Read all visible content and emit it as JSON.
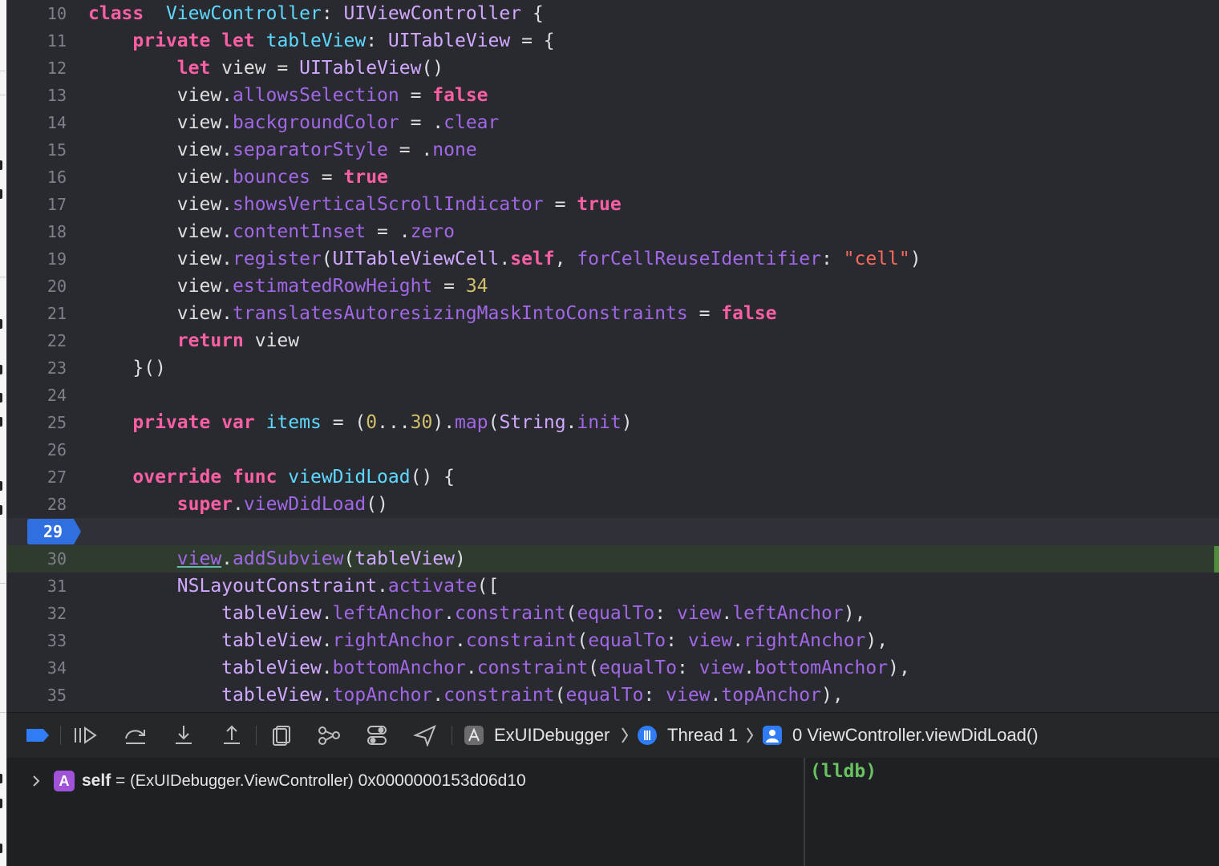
{
  "editor": {
    "lines": [
      {
        "n": "10",
        "code": [
          [
            "kw",
            "class"
          ],
          [
            "",
            "  "
          ],
          [
            "dc",
            "ViewController"
          ],
          [
            "",
            ": "
          ],
          [
            "ty",
            "UIViewController"
          ],
          [
            "",
            " {"
          ]
        ]
      },
      {
        "n": "11",
        "code": [
          [
            "",
            "    "
          ],
          [
            "kw",
            "private"
          ],
          [
            "",
            " "
          ],
          [
            "kw",
            "let"
          ],
          [
            "",
            " "
          ],
          [
            "dc",
            "tableView"
          ],
          [
            "",
            ": "
          ],
          [
            "ty",
            "UITableView"
          ],
          [
            "",
            " = {"
          ]
        ]
      },
      {
        "n": "12",
        "code": [
          [
            "",
            "        "
          ],
          [
            "kw",
            "let"
          ],
          [
            "",
            " view = "
          ],
          [
            "ty",
            "UITableView"
          ],
          [
            "",
            "()"
          ]
        ]
      },
      {
        "n": "13",
        "code": [
          [
            "",
            "        view."
          ],
          [
            "pr",
            "allowsSelection"
          ],
          [
            "",
            " = "
          ],
          [
            "kw",
            "false"
          ]
        ]
      },
      {
        "n": "14",
        "code": [
          [
            "",
            "        view."
          ],
          [
            "pr",
            "backgroundColor"
          ],
          [
            "",
            " = ."
          ],
          [
            "pr",
            "clear"
          ]
        ]
      },
      {
        "n": "15",
        "code": [
          [
            "",
            "        view."
          ],
          [
            "pr",
            "separatorStyle"
          ],
          [
            "",
            " = ."
          ],
          [
            "pr",
            "none"
          ]
        ]
      },
      {
        "n": "16",
        "code": [
          [
            "",
            "        view."
          ],
          [
            "pr",
            "bounces"
          ],
          [
            "",
            " = "
          ],
          [
            "kw",
            "true"
          ]
        ]
      },
      {
        "n": "17",
        "code": [
          [
            "",
            "        view."
          ],
          [
            "pr",
            "showsVerticalScrollIndicator"
          ],
          [
            "",
            " = "
          ],
          [
            "kw",
            "true"
          ]
        ]
      },
      {
        "n": "18",
        "code": [
          [
            "",
            "        view."
          ],
          [
            "pr",
            "contentInset"
          ],
          [
            "",
            " = ."
          ],
          [
            "pr",
            "zero"
          ]
        ]
      },
      {
        "n": "19",
        "code": [
          [
            "",
            "        view."
          ],
          [
            "pr",
            "register"
          ],
          [
            "",
            "("
          ],
          [
            "ty",
            "UITableViewCell"
          ],
          [
            "",
            "."
          ],
          [
            "kw",
            "self"
          ],
          [
            "",
            ", "
          ],
          [
            "pr",
            "forCellReuseIdentifier"
          ],
          [
            "",
            ": "
          ],
          [
            "st",
            "\"cell\""
          ],
          [
            "",
            ")"
          ]
        ]
      },
      {
        "n": "20",
        "code": [
          [
            "",
            "        view."
          ],
          [
            "pr",
            "estimatedRowHeight"
          ],
          [
            "",
            " = "
          ],
          [
            "nm",
            "34"
          ]
        ]
      },
      {
        "n": "21",
        "code": [
          [
            "",
            "        view."
          ],
          [
            "pr",
            "translatesAutoresizingMaskIntoConstraints"
          ],
          [
            "",
            " = "
          ],
          [
            "kw",
            "false"
          ]
        ]
      },
      {
        "n": "22",
        "code": [
          [
            "",
            "        "
          ],
          [
            "kw",
            "return"
          ],
          [
            "",
            " view"
          ]
        ]
      },
      {
        "n": "23",
        "code": [
          [
            "",
            "    }()"
          ]
        ]
      },
      {
        "n": "24",
        "code": []
      },
      {
        "n": "25",
        "code": [
          [
            "",
            "    "
          ],
          [
            "kw",
            "private"
          ],
          [
            "",
            " "
          ],
          [
            "kw",
            "var"
          ],
          [
            "",
            " "
          ],
          [
            "dc",
            "items"
          ],
          [
            "",
            " = ("
          ],
          [
            "nm",
            "0"
          ],
          [
            "",
            "..."
          ],
          [
            "nm",
            "30"
          ],
          [
            "",
            ")."
          ],
          [
            "pr",
            "map"
          ],
          [
            "",
            "("
          ],
          [
            "ty",
            "String"
          ],
          [
            "",
            "."
          ],
          [
            "pr",
            "init"
          ],
          [
            "",
            ")"
          ]
        ]
      },
      {
        "n": "26",
        "code": []
      },
      {
        "n": "27",
        "code": [
          [
            "",
            "    "
          ],
          [
            "kw",
            "override"
          ],
          [
            "",
            " "
          ],
          [
            "kw",
            "func"
          ],
          [
            "",
            " "
          ],
          [
            "dc",
            "viewDidLoad"
          ],
          [
            "",
            "() {"
          ]
        ]
      },
      {
        "n": "28",
        "code": [
          [
            "",
            "        "
          ],
          [
            "kw",
            "super"
          ],
          [
            "",
            "."
          ],
          [
            "pr",
            "viewDidLoad"
          ],
          [
            "",
            "()"
          ]
        ]
      },
      {
        "n": "29",
        "code": [],
        "breakpoint": true
      },
      {
        "n": "30",
        "code": [
          [
            "",
            "        "
          ],
          [
            "pr ul",
            "view"
          ],
          [
            "",
            "."
          ],
          [
            "pr",
            "addSubview"
          ],
          [
            "",
            "("
          ],
          [
            "ty",
            "tableView"
          ],
          [
            "",
            ")"
          ]
        ],
        "paused": true
      },
      {
        "n": "31",
        "code": [
          [
            "",
            "        "
          ],
          [
            "ty",
            "NSLayoutConstraint"
          ],
          [
            "",
            "."
          ],
          [
            "pr",
            "activate"
          ],
          [
            "",
            "(["
          ]
        ]
      },
      {
        "n": "32",
        "code": [
          [
            "",
            "            "
          ],
          [
            "ty",
            "tableView"
          ],
          [
            "",
            "."
          ],
          [
            "pr",
            "leftAnchor"
          ],
          [
            "",
            "."
          ],
          [
            "pr",
            "constraint"
          ],
          [
            "",
            "("
          ],
          [
            "pr",
            "equalTo"
          ],
          [
            "",
            ": "
          ],
          [
            "pr",
            "view"
          ],
          [
            "",
            "."
          ],
          [
            "pr",
            "leftAnchor"
          ],
          [
            "",
            "),"
          ]
        ]
      },
      {
        "n": "33",
        "code": [
          [
            "",
            "            "
          ],
          [
            "ty",
            "tableView"
          ],
          [
            "",
            "."
          ],
          [
            "pr",
            "rightAnchor"
          ],
          [
            "",
            "."
          ],
          [
            "pr",
            "constraint"
          ],
          [
            "",
            "("
          ],
          [
            "pr",
            "equalTo"
          ],
          [
            "",
            ": "
          ],
          [
            "pr",
            "view"
          ],
          [
            "",
            "."
          ],
          [
            "pr",
            "rightAnchor"
          ],
          [
            "",
            "),"
          ]
        ]
      },
      {
        "n": "34",
        "code": [
          [
            "",
            "            "
          ],
          [
            "ty",
            "tableView"
          ],
          [
            "",
            "."
          ],
          [
            "pr",
            "bottomAnchor"
          ],
          [
            "",
            "."
          ],
          [
            "pr",
            "constraint"
          ],
          [
            "",
            "("
          ],
          [
            "pr",
            "equalTo"
          ],
          [
            "",
            ": "
          ],
          [
            "pr",
            "view"
          ],
          [
            "",
            "."
          ],
          [
            "pr",
            "bottomAnchor"
          ],
          [
            "",
            "),"
          ]
        ]
      },
      {
        "n": "35",
        "code": [
          [
            "",
            "            "
          ],
          [
            "ty",
            "tableView"
          ],
          [
            "",
            "."
          ],
          [
            "pr",
            "topAnchor"
          ],
          [
            "",
            "."
          ],
          [
            "pr",
            "constraint"
          ],
          [
            "",
            "("
          ],
          [
            "pr",
            "equalTo"
          ],
          [
            "",
            ": "
          ],
          [
            "pr",
            "view"
          ],
          [
            "",
            "."
          ],
          [
            "pr",
            "topAnchor"
          ],
          [
            "",
            "),"
          ]
        ]
      }
    ]
  },
  "debug_bar": {
    "buttons": [
      {
        "name": "breakpoints-toggle-icon"
      },
      {
        "name": "continue-icon"
      },
      {
        "name": "step-over-icon"
      },
      {
        "name": "step-into-icon"
      },
      {
        "name": "step-out-icon"
      },
      {
        "name": "view-hierarchy-icon"
      },
      {
        "name": "memory-graph-icon"
      },
      {
        "name": "environment-overrides-icon"
      },
      {
        "name": "simulate-location-icon"
      }
    ],
    "breadcrumb": {
      "app": "ExUIDebugger",
      "thread": "Thread 1",
      "frame": "0 ViewController.viewDidLoad()"
    }
  },
  "variables": {
    "badge": "A",
    "name": "self",
    "equals": " = ",
    "type": "(ExUIDebugger.ViewController)",
    "value": "0x0000000153d06d10"
  },
  "console": {
    "prompt": "(lldb)"
  },
  "colors": {
    "keyword": "#fc5fa3",
    "type": "#d0a8ff",
    "declaration": "#5dd8ff",
    "property": "#a167e6",
    "string": "#fc6a5d",
    "number": "#d0bf69",
    "breakpoint": "#2f6fe0",
    "lldb_prompt": "#67c25f"
  }
}
